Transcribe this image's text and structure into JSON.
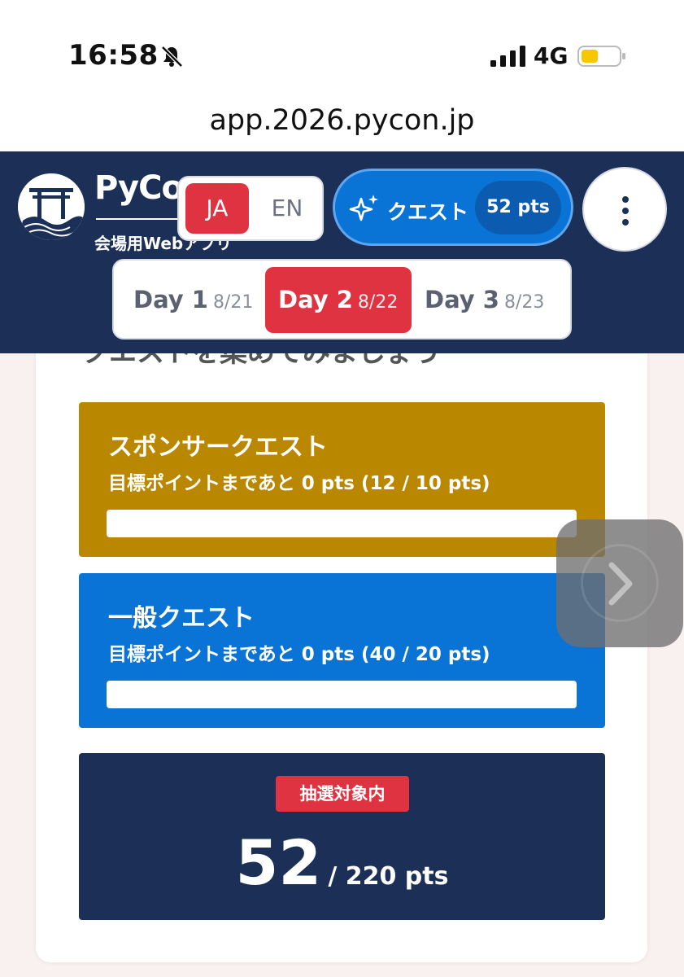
{
  "status_bar": {
    "time": "16:58",
    "network": "4G"
  },
  "browser": {
    "url": "app.2026.pycon.jp"
  },
  "background": {
    "ghost_title": "クエストを集めてみましょう"
  },
  "header": {
    "brand": "PyCon",
    "subtitle": "会場用Webアプリ",
    "lang": {
      "ja": "JA",
      "en": "EN",
      "active": "JA"
    },
    "quest_button": {
      "label": "クエスト",
      "points": "52 pts"
    },
    "days": [
      {
        "name": "Day 1",
        "date": "8/21"
      },
      {
        "name": "Day 2",
        "date": "8/22",
        "active": true
      },
      {
        "name": "Day 3",
        "date": "8/23"
      }
    ]
  },
  "quests": {
    "sponsor": {
      "title": "スポンサークエスト",
      "progress_text": "目標ポイントまであと 0 pts (12 / 10 pts)",
      "progress_fraction": 1.0,
      "color": "#b98800"
    },
    "general": {
      "title": "一般クエスト",
      "progress_text": "目標ポイントまであと 0 pts (40 / 20 pts)",
      "progress_fraction": 1.0,
      "color": "#0a74d6"
    }
  },
  "total": {
    "badge": "抽選対象内",
    "points": "52",
    "max": "/ 220 pts"
  },
  "colors": {
    "navy": "#1b2f57",
    "red": "#e03341",
    "blue": "#0a74d6",
    "gold": "#b98800"
  }
}
